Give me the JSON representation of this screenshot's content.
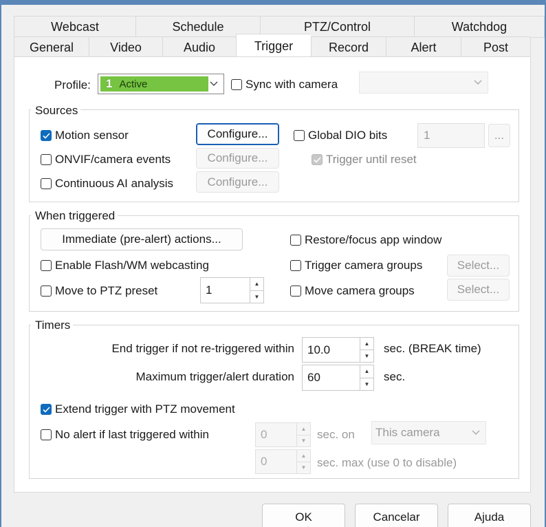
{
  "tabs_row1": [
    "Webcast",
    "Schedule",
    "PTZ/Control",
    "Watchdog"
  ],
  "tabs_row2": [
    "General",
    "Video",
    "Audio",
    "Trigger",
    "Record",
    "Alert",
    "Post"
  ],
  "active_tab": "Trigger",
  "profile": {
    "label": "Profile:",
    "number": "1",
    "value": "Active",
    "color": "#76c442",
    "sync_label": "Sync with camera",
    "sync_checked": false
  },
  "sources": {
    "title": "Sources",
    "motion_sensor": {
      "label": "Motion sensor",
      "checked": true
    },
    "onvif": {
      "label": "ONVIF/camera events",
      "checked": false
    },
    "continuous_ai": {
      "label": "Continuous AI analysis",
      "checked": false
    },
    "configure_label": "Configure...",
    "global_dio": {
      "label": "Global DIO bits",
      "checked": false,
      "value": "1",
      "more": "..."
    },
    "trigger_until_reset": {
      "label": "Trigger until reset",
      "checked": true
    }
  },
  "when_triggered": {
    "title": "When triggered",
    "immediate_label": "Immediate (pre-alert) actions...",
    "enable_flash": "Enable Flash/WM webcasting",
    "move_ptz": "Move to PTZ preset",
    "ptz_value": "1",
    "restore_focus": "Restore/focus app window",
    "trigger_groups": "Trigger camera groups",
    "move_groups": "Move camera groups",
    "select_label": "Select..."
  },
  "timers": {
    "title": "Timers",
    "end_trigger_label": "End trigger if not re-triggered within",
    "end_trigger_value": "10.0",
    "end_trigger_unit": "sec. (BREAK time)",
    "max_duration_label": "Maximum trigger/alert duration",
    "max_duration_value": "60",
    "max_duration_unit": "sec.",
    "extend_ptz": {
      "label": "Extend trigger with PTZ movement",
      "checked": true
    },
    "no_alert": {
      "label": "No alert if last triggered within",
      "checked": false
    },
    "no_alert_value": "0",
    "sec_on": "sec. on",
    "camera_select": "This camera",
    "max_value": "0",
    "sec_max": "sec. max (use 0 to disable)"
  },
  "footer": {
    "ok": "OK",
    "cancel": "Cancelar",
    "help": "Ajuda"
  },
  "colors": {
    "accent": "#0f6cbd",
    "frame": "#5b86b8"
  }
}
